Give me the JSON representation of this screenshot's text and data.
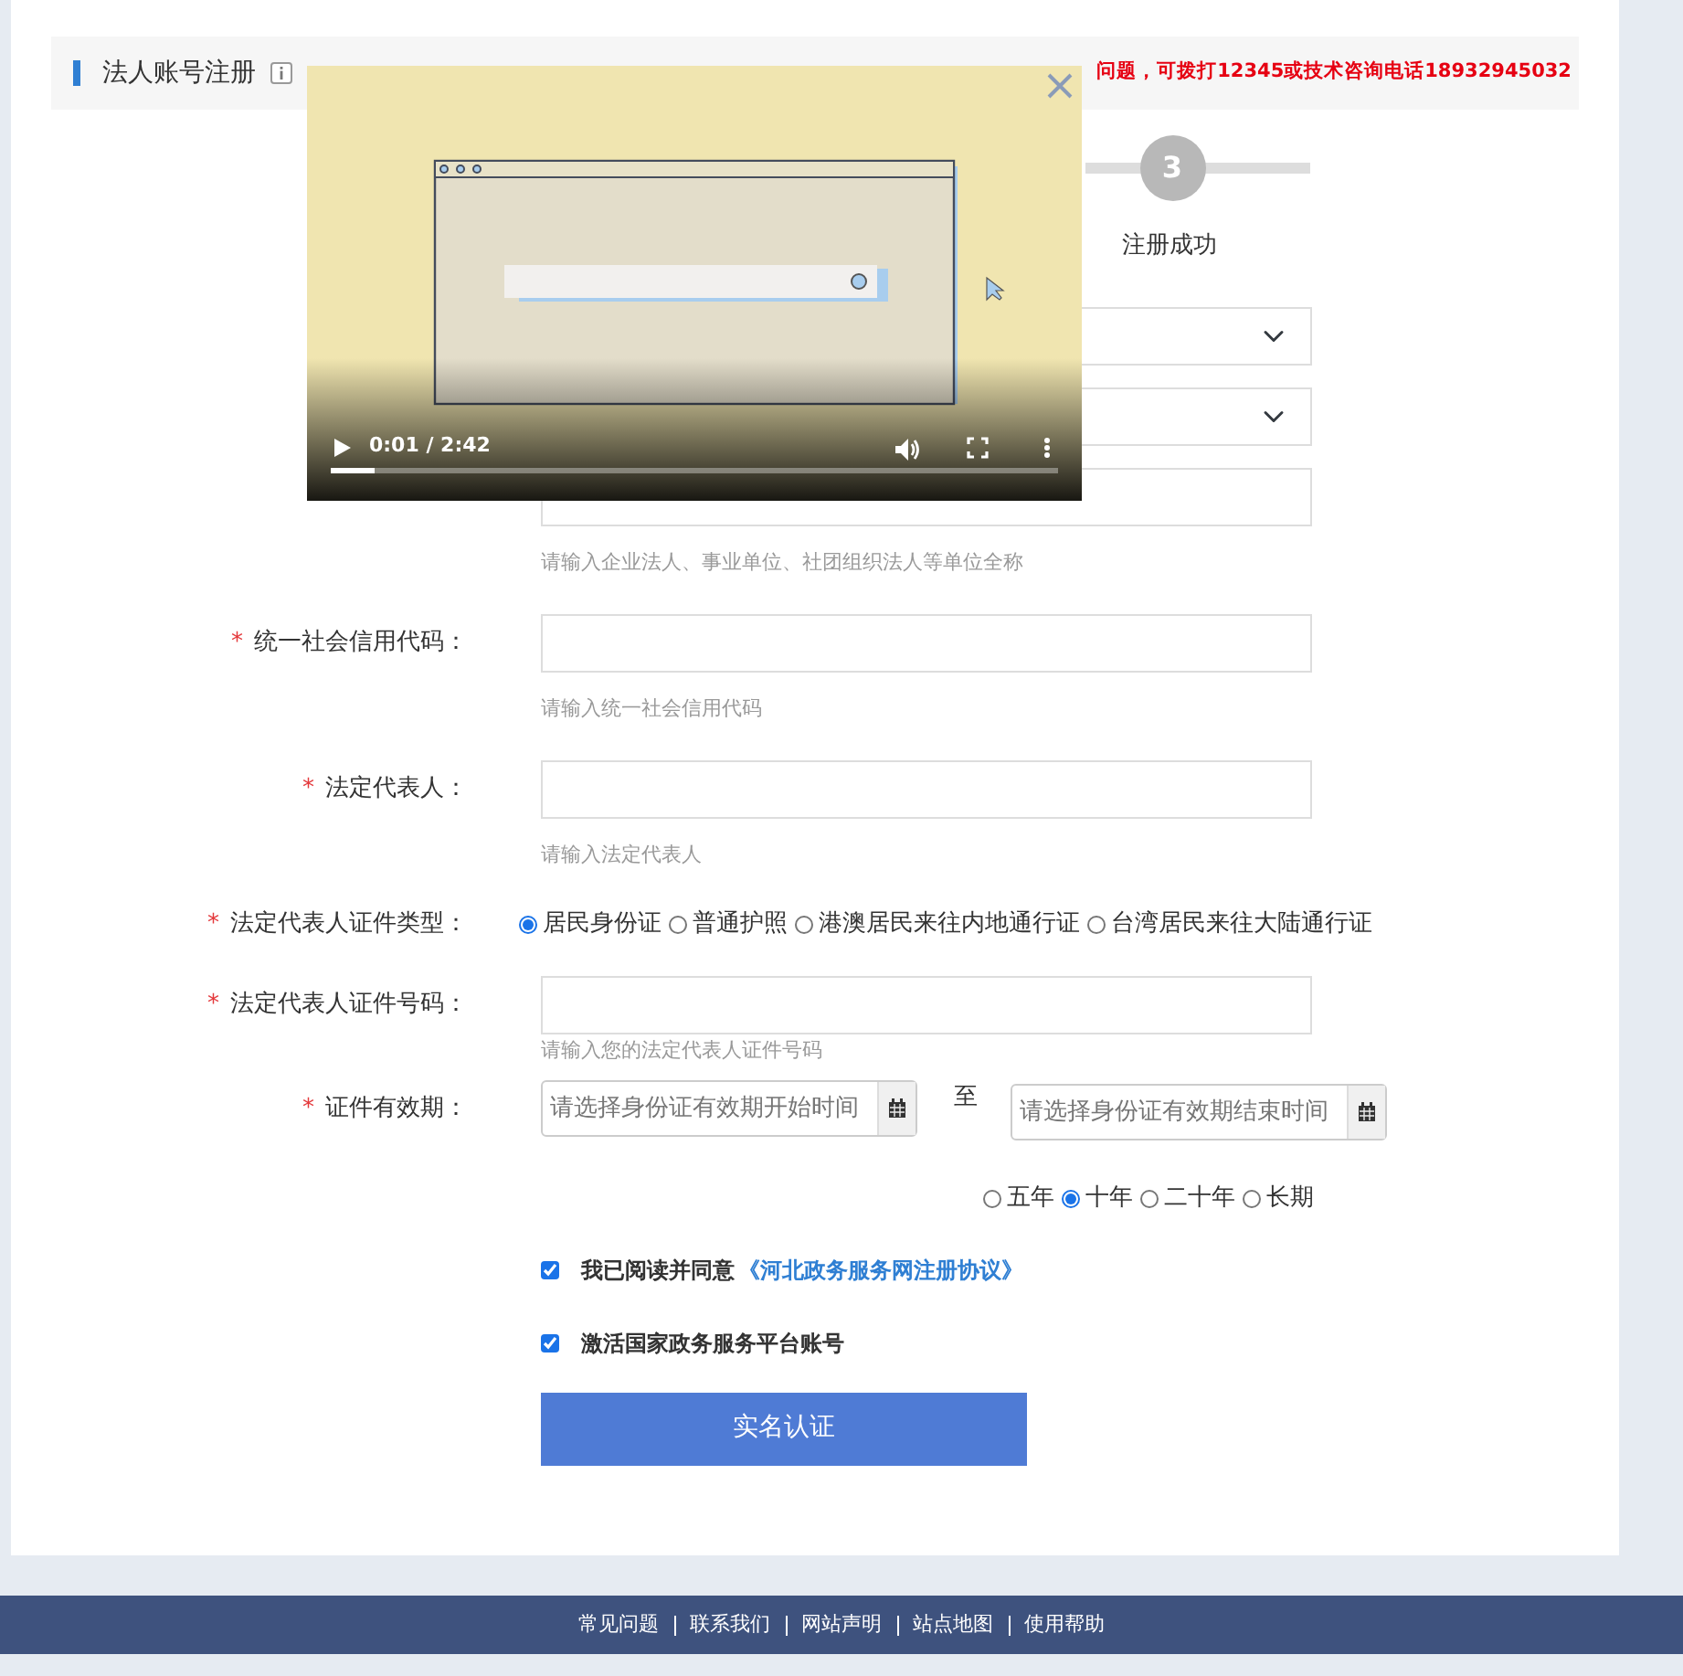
{
  "header": {
    "title": "法人账号注册",
    "notice": "问题，可拨打12345或技术咨询电话18932945032"
  },
  "steps": [
    {
      "number": "3",
      "label": "注册成功"
    }
  ],
  "fields": [
    {
      "kind": "select"
    },
    {
      "kind": "select"
    },
    {
      "kind": "text",
      "hint": "请输入企业法人、事业单位、社团组织法人等单位全称"
    },
    {
      "kind": "text",
      "required_mark": "*",
      "label": "统一社会信用代码：",
      "hint": "请输入统一社会信用代码"
    },
    {
      "kind": "text",
      "required_mark": "*",
      "label": "法定代表人：",
      "hint": "请输入法定代表人"
    },
    {
      "kind": "radio",
      "required_mark": "*",
      "label": "法定代表人证件类型：",
      "options": [
        {
          "label": "居民身份证",
          "selected": true
        },
        {
          "label": "普通护照",
          "selected": false
        },
        {
          "label": "港澳居民来往内地通行证",
          "selected": false
        },
        {
          "label": "台湾居民来往大陆通行证",
          "selected": false
        }
      ]
    },
    {
      "kind": "text",
      "required_mark": "*",
      "label": "法定代表人证件号码：",
      "hint": "请输入您的法定代表人证件号码"
    },
    {
      "kind": "daterange",
      "required_mark": "*",
      "label": "证件有效期：",
      "start_placeholder": "请选择身份证有效期开始时间",
      "separator": "至",
      "end_placeholder": "请选择身份证有效期结束时间",
      "options": [
        {
          "label": "五年",
          "selected": false
        },
        {
          "label": "十年",
          "selected": true
        },
        {
          "label": "二十年",
          "selected": false
        },
        {
          "label": "长期",
          "selected": false
        }
      ]
    }
  ],
  "agreements": [
    {
      "checked": true,
      "text": "我已阅读并同意",
      "link": "《河北政务服务网注册协议》"
    },
    {
      "checked": true,
      "text": "激活国家政务服务平台账号"
    }
  ],
  "submit": "实名认证",
  "video": {
    "time": "0:01 / 2:42",
    "level": 0.06
  },
  "footer": [
    "常见问题",
    "联系我们",
    "网站声明",
    "站点地图",
    "使用帮助"
  ]
}
